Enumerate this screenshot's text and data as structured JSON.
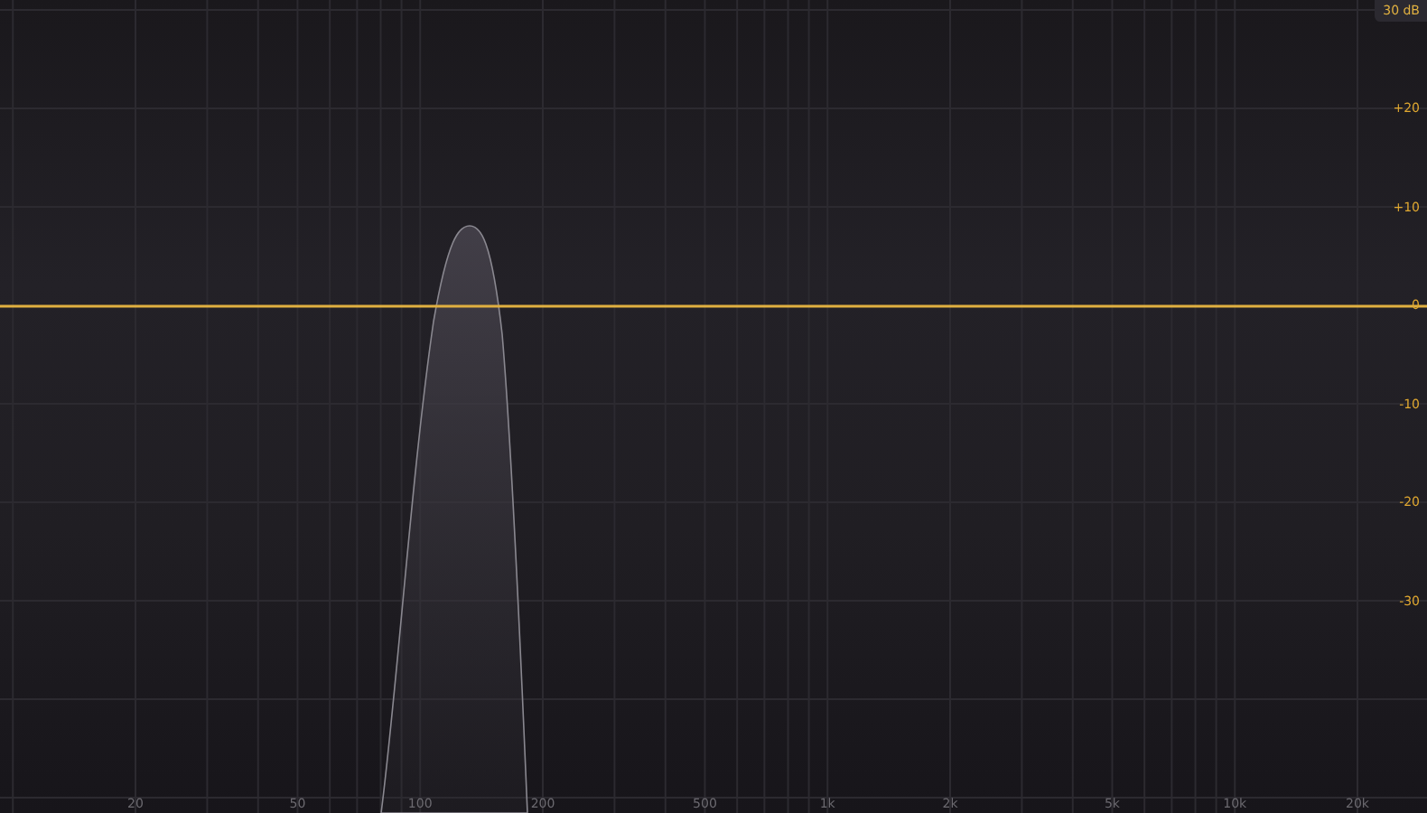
{
  "range_badge": "30 dB",
  "gain_scale": [
    "+20",
    "+10",
    "0",
    "-10",
    "-20",
    "-30"
  ],
  "frequency_scale": [
    "20",
    "50",
    "100",
    "200",
    "500",
    "1k",
    "2k",
    "5k",
    "10k",
    "20k"
  ]
}
